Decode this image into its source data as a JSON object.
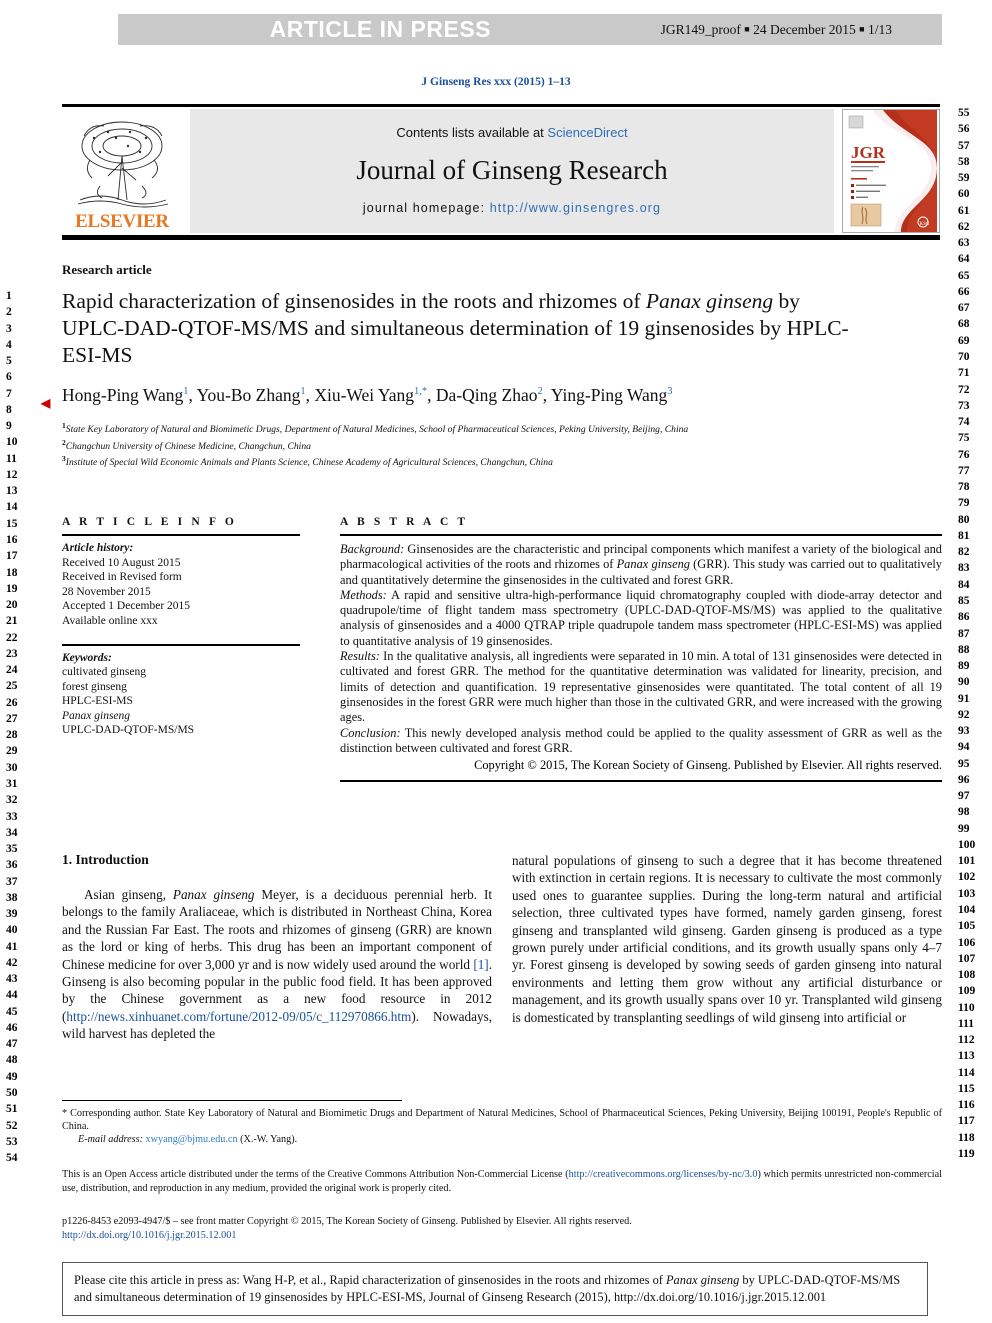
{
  "press_banner": {
    "title": "ARTICLE IN PRESS",
    "proof_id": "JGR149_proof",
    "date": "24 December 2015",
    "page": "1/13"
  },
  "journal_ref": "J Ginseng Res xxx (2015) 1–13",
  "masthead": {
    "contents_prefix": "Contents lists available at ",
    "contents_link": "ScienceDirect",
    "journal_name": "Journal of Ginseng Research",
    "homepage_prefix": "journal homepage: ",
    "homepage_url": "http://www.ginsengres.org",
    "publisher_wordmark": "ELSEVIER",
    "cover_label": "JGR"
  },
  "article": {
    "type": "Research article",
    "title_line1": "Rapid characterization of ginsenosides in the roots and rhizomes of",
    "title_italic": "Panax ginseng",
    "title_line2_rest": " by UPLC-DAD-QTOF-MS/MS and simultaneous",
    "title_line3": "determination of 19 ginsenosides by HPLC-ESI-MS",
    "authors": [
      {
        "name": "Hong-Ping Wang",
        "sup": "1"
      },
      {
        "name": "You-Bo Zhang",
        "sup": "1"
      },
      {
        "name": "Xiu-Wei Yang",
        "sup": "1,*"
      },
      {
        "name": "Da-Qing Zhao",
        "sup": "2"
      },
      {
        "name": "Ying-Ping Wang",
        "sup": "3"
      }
    ],
    "affiliations": [
      {
        "sup": "1",
        "text": "State Key Laboratory of Natural and Biomimetic Drugs, Department of Natural Medicines, School of Pharmaceutical Sciences, Peking University, Beijing, China"
      },
      {
        "sup": "2",
        "text": "Changchun University of Chinese Medicine, Changchun, China"
      },
      {
        "sup": "3",
        "text": "Institute of Special Wild Economic Animals and Plants Science, Chinese Academy of Agricultural Sciences, Changchun, China"
      }
    ]
  },
  "article_info": {
    "heading": "A R T I C L E  I N F O",
    "history_label": "Article history:",
    "history_lines": [
      "Received 10 August 2015",
      "Received in Revised form",
      "28 November 2015",
      "Accepted 1 December 2015",
      "Available online xxx"
    ],
    "keywords_label": "Keywords:",
    "keywords": [
      "cultivated ginseng",
      "forest ginseng",
      "HPLC-ESI-MS",
      "Panax ginseng",
      "UPLC-DAD-QTOF-MS/MS"
    ],
    "keywords_italic_index": 3
  },
  "abstract": {
    "heading": "A B S T R A C T",
    "sections": [
      {
        "label": "Background:",
        "text": " Ginsenosides are the characteristic and principal components which manifest a variety of the biological and pharmacological activities of the roots and rhizomes of ",
        "italic_term": "Panax ginseng",
        "text_after": " (GRR). This study was carried out to qualitatively and quantitatively determine the ginsenosides in the cultivated and forest GRR."
      },
      {
        "label": "Methods:",
        "text": " A rapid and sensitive ultra-high-performance liquid chromatography coupled with diode-array detector and quadrupole/time of flight tandem mass spectrometry (UPLC-DAD-QTOF-MS/MS) was applied to the qualitative analysis of ginsenosides and a 4000 QTRAP triple quadrupole tandem mass spectrometer (HPLC-ESI-MS) was applied to quantitative analysis of 19 ginsenosides.",
        "italic_term": "",
        "text_after": ""
      },
      {
        "label": "Results:",
        "text": " In the qualitative analysis, all ingredients were separated in 10 min. A total of 131 ginsenosides were detected in cultivated and forest GRR. The method for the quantitative determination was validated for linearity, precision, and limits of detection and quantification. 19 representative ginsenosides were quantitated. The total content of all 19 ginsenosides in the forest GRR were much higher than those in the cultivated GRR, and were increased with the growing ages.",
        "italic_term": "",
        "text_after": ""
      },
      {
        "label": "Conclusion:",
        "text": " This newly developed analysis method could be applied to the quality assessment of GRR as well as the distinction between cultivated and forest GRR.",
        "italic_term": "",
        "text_after": ""
      }
    ],
    "copyright": "Copyright © 2015, The Korean Society of Ginseng. Published by Elsevier. All rights reserved."
  },
  "introduction": {
    "heading": "1. Introduction",
    "left_para_a": "Asian ginseng, ",
    "left_italic_a": "Panax ginseng",
    "left_para_b": " Meyer, is a deciduous perennial herb. It belongs to the family Araliaceae, which is distributed in Northeast China, Korea and the Russian Far East. The roots and rhizomes of ginseng (GRR) are known as the lord or king of herbs. This drug has been an important component of Chinese medicine for over 3,000 yr and is now widely used around the world ",
    "left_ref": "[1]",
    "left_para_c": ". Ginseng is also becoming popular in the public food field. It has been approved by the Chinese government as a new food resource in 2012 (",
    "left_link": "http://news.xinhuanet.com/fortune/2012-09/05/c_112970866.htm",
    "left_para_d": "). Nowadays, wild harvest has depleted the",
    "right_para": "natural populations of ginseng to such a degree that it has become threatened with extinction in certain regions. It is necessary to cultivate the most commonly used ones to guarantee supplies. During the long-term natural and artificial selection, three cultivated types have formed, namely garden ginseng, forest ginseng and transplanted wild ginseng. Garden ginseng is produced as a type grown purely under artificial conditions, and its growth usually spans only 4–7 yr. Forest ginseng is developed by sowing seeds of garden ginseng into natural environments and letting them grow without any artificial disturbance or management, and its growth usually spans over 10 yr. Transplanted wild ginseng is domesticated by transplanting seedlings of wild ginseng into artificial or"
  },
  "footnotes": {
    "corresponding_marker": "*",
    "corresponding_text": " Corresponding author. State Key Laboratory of Natural and Biomimetic Drugs and Department of Natural Medicines, School of Pharmaceutical Sciences, Peking University, Beijing 100191, People's Republic of China.",
    "email_label": "E-mail address:",
    "email": "xwyang@bjmu.edu.cn",
    "email_suffix": " (X.-W. Yang).",
    "open_access_a": "This is an Open Access article distributed under the terms of the Creative Commons Attribution Non-Commercial License (",
    "open_access_link": "http://creativecommons.org/licenses/by-nc/3.0",
    "open_access_b": ") which permits unrestricted non-commercial use, distribution, and reproduction in any medium, provided the original work is properly cited.",
    "issn_line": "p1226-8453 e2093-4947/$ – see front matter Copyright © 2015, The Korean Society of Ginseng. Published by Elsevier. All rights reserved.",
    "doi_link": "http://dx.doi.org/10.1016/j.jgr.2015.12.001"
  },
  "cite_box": {
    "prefix": "Please cite this article in press as: Wang H-P, et al., Rapid characterization of ginsenosides in the roots and rhizomes of ",
    "italic": "Panax ginseng",
    "suffix": " by UPLC-DAD-QTOF-MS/MS and simultaneous determination of 19 ginsenosides by HPLC-ESI-MS, Journal of Ginseng Research (2015), http://dx.doi.org/10.1016/j.jgr.2015.12.001"
  },
  "line_numbers": {
    "left_start": 1,
    "left_end": 54,
    "right_start": 55,
    "right_end": 119
  },
  "colors": {
    "link": "#1a4f9c",
    "banner_bg": "#c9c9c9",
    "elsevier_orange": "#E87722",
    "masthead_bg": "#e8e8e8",
    "marker_red": "#cc0000"
  }
}
